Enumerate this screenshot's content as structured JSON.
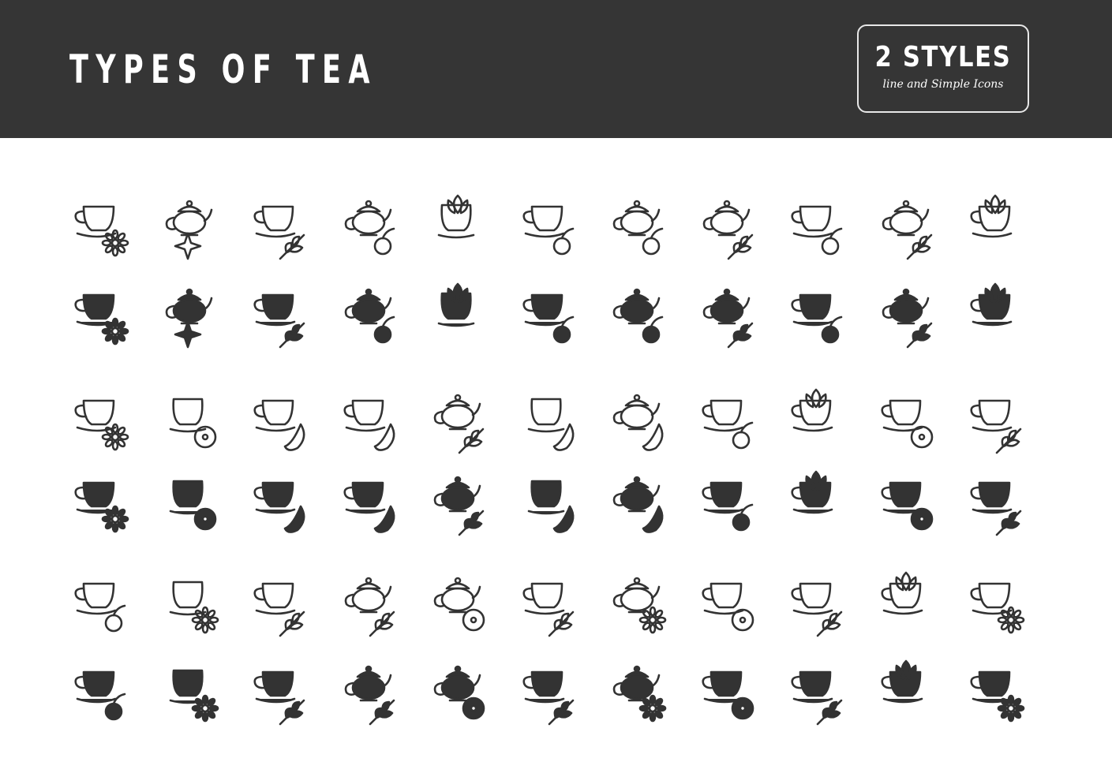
{
  "header": {
    "title": "TYPES OF TEA",
    "badge_main": "2 STYLES",
    "badge_sub": "line and Simple Icons"
  },
  "colors": {
    "header_bg": "#353535",
    "icon": "#333333",
    "background": "#ffffff",
    "text": "#ffffff"
  },
  "icon_groups": [
    {
      "icons": [
        {
          "name": "chamomile-tea",
          "vessel": "cup",
          "accent": "daisy"
        },
        {
          "name": "star-anise-tea",
          "vessel": "teapot",
          "accent": "star"
        },
        {
          "name": "mint-tea",
          "vessel": "cup",
          "accent": "leaves-cross"
        },
        {
          "name": "rosehip-tea",
          "vessel": "teapot",
          "accent": "rose"
        },
        {
          "name": "hibiscus-tea",
          "vessel": "bowl",
          "accent": "flower-top"
        },
        {
          "name": "blackberry-tea",
          "vessel": "cup",
          "accent": "berry-leaf"
        },
        {
          "name": "apple-tea",
          "vessel": "teapot",
          "accent": "apple-leaf"
        },
        {
          "name": "currant-tea",
          "vessel": "teapot",
          "accent": "leaf-berry"
        },
        {
          "name": "raspberry-tea",
          "vessel": "cup",
          "accent": "raspberry"
        },
        {
          "name": "herbal-sprig-tea",
          "vessel": "teapot",
          "accent": "sprig"
        },
        {
          "name": "flower-tea",
          "vessel": "cup",
          "accent": "flower-top"
        }
      ]
    },
    {
      "icons": [
        {
          "name": "jasmine-tea",
          "vessel": "cup",
          "accent": "star-flower"
        },
        {
          "name": "lemon-slice-tea",
          "vessel": "bowl",
          "accent": "citrus-round"
        },
        {
          "name": "orange-tea",
          "vessel": "cup",
          "accent": "orange-wedge"
        },
        {
          "name": "lime-tea",
          "vessel": "cup",
          "accent": "citrus-wedge"
        },
        {
          "name": "clove-tea",
          "vessel": "teapot",
          "accent": "clove"
        },
        {
          "name": "avocado-tea",
          "vessel": "bowl",
          "accent": "avocado"
        },
        {
          "name": "peach-tea",
          "vessel": "teapot",
          "accent": "peach"
        },
        {
          "name": "cherry-tea",
          "vessel": "cup",
          "accent": "cherry"
        },
        {
          "name": "lotus-tea",
          "vessel": "cup",
          "accent": "lotus"
        },
        {
          "name": "lychee-tea",
          "vessel": "cup",
          "accent": "balls"
        },
        {
          "name": "coffee-bean-tea",
          "vessel": "cup",
          "accent": "beans"
        }
      ]
    },
    {
      "icons": [
        {
          "name": "maple-tea",
          "vessel": "cup",
          "accent": "maple-berry"
        },
        {
          "name": "passion-flower-tea",
          "vessel": "bowl",
          "accent": "star-flower"
        },
        {
          "name": "fern-tea",
          "vessel": "cup",
          "accent": "fern"
        },
        {
          "name": "willow-leaf-tea",
          "vessel": "teapot",
          "accent": "big-leaves"
        },
        {
          "name": "sea-buckthorn-tea",
          "vessel": "teapot",
          "accent": "round-berry"
        },
        {
          "name": "green-leaf-tea",
          "vessel": "cup",
          "accent": "fern-top"
        },
        {
          "name": "chestnut-flower-tea",
          "vessel": "teapot",
          "accent": "star-flower"
        },
        {
          "name": "kumquat-tea",
          "vessel": "cup",
          "accent": "citrus-round"
        },
        {
          "name": "rowan-tea",
          "vessel": "cup",
          "accent": "fern"
        },
        {
          "name": "water-lily-tea",
          "vessel": "cup",
          "accent": "lotus"
        },
        {
          "name": "clematis-tea",
          "vessel": "cup",
          "accent": "daisy"
        }
      ]
    }
  ],
  "styles": [
    "line",
    "solid"
  ]
}
